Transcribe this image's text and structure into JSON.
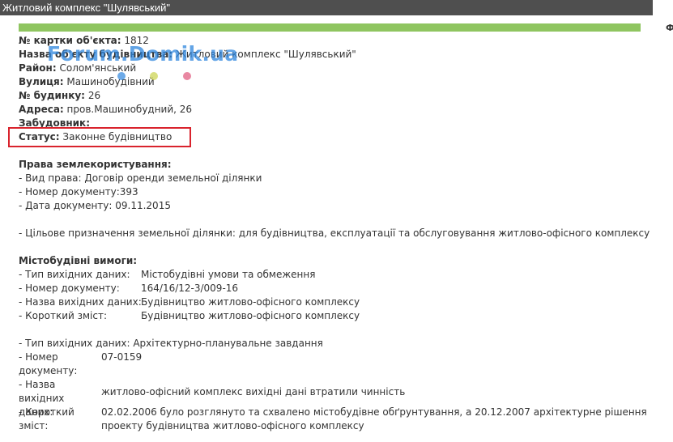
{
  "window": {
    "title": "Житловий комплекс \"Шулявський\"",
    "side_letter": "Ф"
  },
  "watermark": "Forum.Domik.ua",
  "colors": {
    "titlebar": "#4f4f4f",
    "green_bar": "#8fc560",
    "highlight": "#d9232d",
    "watermark": "#2e86de"
  },
  "fields": [
    {
      "label": "№ картки об'єкта:",
      "value": "1812"
    },
    {
      "label": "Назва об'єкту будівництва:",
      "value": "Житловий комплекс \"Шулявський\""
    },
    {
      "label": "Район:",
      "value": "Солом'янський"
    },
    {
      "label": "Вулиця:",
      "value": "Машинобудівний"
    },
    {
      "label": "№ будинку:",
      "value": "26"
    },
    {
      "label": "Адреса:",
      "value": "пров.Машинобудний, 26"
    },
    {
      "label": "Забудовник:",
      "value": ""
    },
    {
      "label": "Статус:",
      "value": "Законне будівництво"
    }
  ],
  "land": {
    "title": "Права землекористування:",
    "right_type": "- Вид права: Договір оренди земельної ділянки",
    "doc_number": "- Номер документу:393",
    "doc_date": "- Дата документу:   09.11.2015",
    "purpose": "- Цільове призначення земельної ділянки: для будівництва, експлуатації та обслуговування житлово-офісного комплексу"
  },
  "urban": {
    "title": "Містобудівні вимоги:",
    "block1": [
      {
        "k": "- Тип вихідних даних:",
        "v": "Містобудівні умови та обмеження"
      },
      {
        "k": "- Номер документу:",
        "v": "164/16/12-3/009-16"
      },
      {
        "k": "- Назва вихідних даних:",
        "v": "Будівництво житлово-офісного комплексу"
      },
      {
        "k": "- Короткий зміст:",
        "v": "Будівництво житлово-офісного комплексу"
      }
    ],
    "block2_type": "- Тип вихідних даних: Архітектурно-планувальне завдання",
    "block2": [
      {
        "k": "- Номер документу:",
        "v": "07-0159"
      },
      {
        "k": "- Назва вихідних даних:",
        "v": "житлово-офісний комплекс вихідні дані втратили чинність"
      },
      {
        "k": "- Короткий зміст:",
        "v": "02.02.2006 було розглянуто та схвалено містобудівне обґрунтування, а 20.12.2007 архітектурне рішення проекту будівництва житлово-офісного комплексу"
      }
    ]
  }
}
